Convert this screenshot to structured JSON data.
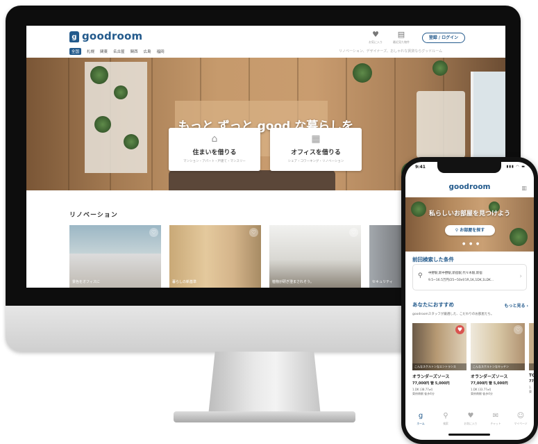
{
  "desktop": {
    "brand": "goodroom",
    "logo_mark": "g",
    "nav": [
      "全国",
      "札幌",
      "関東",
      "名古屋",
      "関西",
      "広島",
      "福岡"
    ],
    "icon_buttons": [
      {
        "icon": "heart-icon",
        "glyph": "♥",
        "caption": "お気に入り"
      },
      {
        "icon": "history-icon",
        "glyph": "▤",
        "caption": "最近見た物件"
      }
    ],
    "login_label": "登録 / ログイン",
    "tagline": "リノベーション、デザイナーズ、おしゃれな賃貸ならグッドルーム",
    "hero": {
      "title": "もっと ずっと good な暮らしを",
      "cards": [
        {
          "icon": "house-icon",
          "glyph": "⌂",
          "title": "住まいを借りる",
          "sub": "マンション・アパート・戸建て・マンスリー"
        },
        {
          "icon": "building-icon",
          "glyph": "▦",
          "title": "オフィスを借りる",
          "sub": "シェア・コワーキング・リノベーション"
        }
      ]
    },
    "renovation": {
      "title": "リノベーション",
      "photos": [
        {
          "caption": "景色をオフィスに"
        },
        {
          "caption": "暮らしの新基準"
        },
        {
          "caption": "植物が研ぎ澄まされそう。"
        },
        {
          "caption": "セキュリティ"
        }
      ]
    },
    "apple_logo": ""
  },
  "phone": {
    "time": "9:41",
    "status": "▮▮▮ ◠ ▬",
    "brand": "goodroom",
    "menu_glyph": "▥",
    "hero_title": "私らしいお部屋を見つけよう",
    "search_button": "お部屋を探す",
    "search_glyph": "⚲",
    "dots": "● ● ●",
    "last_search_title": "前回検索した条件",
    "last_search_line1": "中野駅,新中野駅,新宿駅,代々木駅,新宿",
    "last_search_line2": "9.5~16.5万円/25~50㎡/1R,1K,1DK,1LDK...",
    "recommend_title": "あなたにおすすめ",
    "recommend_more": "もっと見る ›",
    "recommend_desc": "goodroomスタッフが厳選した、こだわりのお部屋たち。",
    "cards": [
      {
        "band": "こんなスケルトンなエントランス",
        "name": "オランダーズソース",
        "price": "77,000円 管 5,000円",
        "meta1": "1.DK (38.77㎡)",
        "meta2": "東府南駅 徒歩4分",
        "liked": true
      },
      {
        "band": "こんなスケルトンなキッチン",
        "name": "オランダーズソース",
        "price": "77,000円 管 5,000円",
        "meta1": "1.DK (33.77㎡)",
        "meta2": "東府南駅 徒歩4分",
        "liked": false
      },
      {
        "band": "",
        "name": "TC",
        "price": "77",
        "meta1": "1.",
        "meta2": "東",
        "liked": false
      }
    ],
    "tabs": [
      {
        "icon": "home-icon",
        "glyph": "g",
        "label": "ホーム",
        "active": true
      },
      {
        "icon": "search-icon",
        "glyph": "⚲",
        "label": "検索",
        "active": false
      },
      {
        "icon": "heart-icon",
        "glyph": "♥",
        "label": "お気に入り",
        "active": false
      },
      {
        "icon": "chat-icon",
        "glyph": "✉",
        "label": "チャット",
        "active": false
      },
      {
        "icon": "user-icon",
        "glyph": "☺",
        "label": "マイページ",
        "active": false
      }
    ]
  },
  "colors": {
    "brand": "#235a8c",
    "heart_active": "#d9534f"
  }
}
